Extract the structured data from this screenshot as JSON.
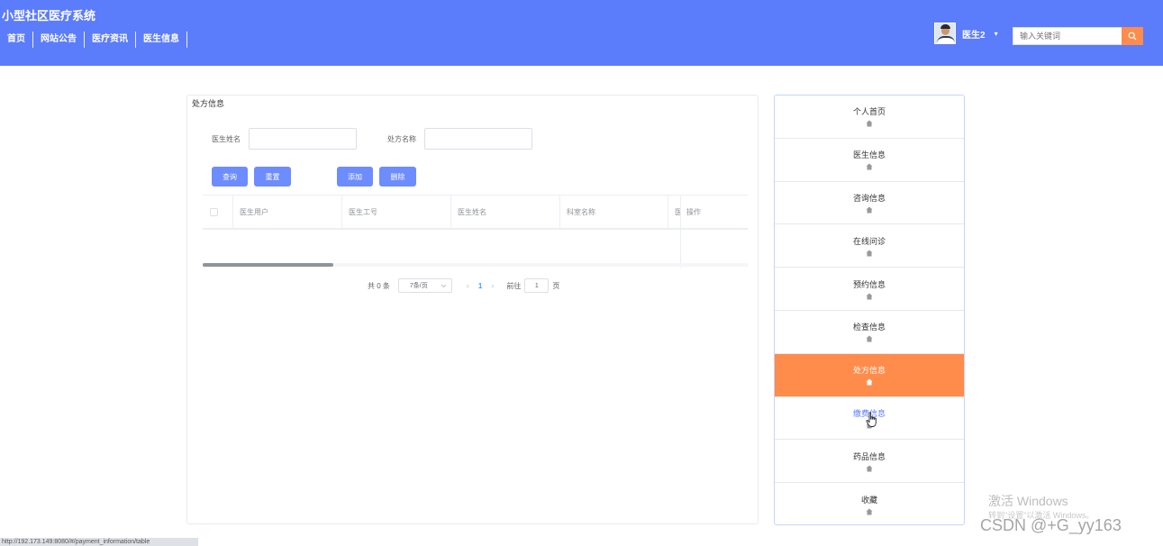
{
  "header": {
    "app_title": "小型社区医疗系统",
    "nav": [
      "首页",
      "网站公告",
      "医疗资讯",
      "医生信息"
    ],
    "username": "医生2",
    "caret": "▾",
    "search_placeholder": "输入关键词",
    "brand_color": "#5b7cfb",
    "accent_color": "#ff8c4b"
  },
  "panel": {
    "title": "处方信息",
    "filters": {
      "doctor_name_label": "医生姓名",
      "prescription_name_label": "处方名称"
    },
    "buttons": {
      "query": "查询",
      "reset": "重置",
      "add": "添加",
      "delete": "删除"
    },
    "table": {
      "columns": [
        "医生用户",
        "医生工号",
        "医生姓名",
        "科室名称",
        "医"
      ],
      "fixed_column": "操作",
      "rows": []
    },
    "pagination": {
      "total": "共 0 条",
      "page_size": "7条/页",
      "current_page": "1",
      "goto_label": "前往",
      "goto_value": "1",
      "page_suffix": "页",
      "prev": "‹",
      "next": "›"
    }
  },
  "menu": {
    "items": [
      {
        "label": "个人首页",
        "state": "normal"
      },
      {
        "label": "医生信息",
        "state": "normal"
      },
      {
        "label": "咨询信息",
        "state": "normal"
      },
      {
        "label": "在线问诊",
        "state": "normal"
      },
      {
        "label": "预约信息",
        "state": "normal"
      },
      {
        "label": "检查信息",
        "state": "normal"
      },
      {
        "label": "处方信息",
        "state": "active"
      },
      {
        "label": "缴费信息",
        "state": "hover"
      },
      {
        "label": "药品信息",
        "state": "normal"
      },
      {
        "label": "收藏",
        "state": "normal"
      }
    ],
    "icon": "home-icon"
  },
  "overlay": {
    "status_url": "http://192.173.149:8080/#/payment_information/table",
    "watermark_line1": "激活 Windows",
    "watermark_line2": "转到\"设置\"以激活 Windows。",
    "watermark_line3": "CSDN @+G_yy163"
  }
}
